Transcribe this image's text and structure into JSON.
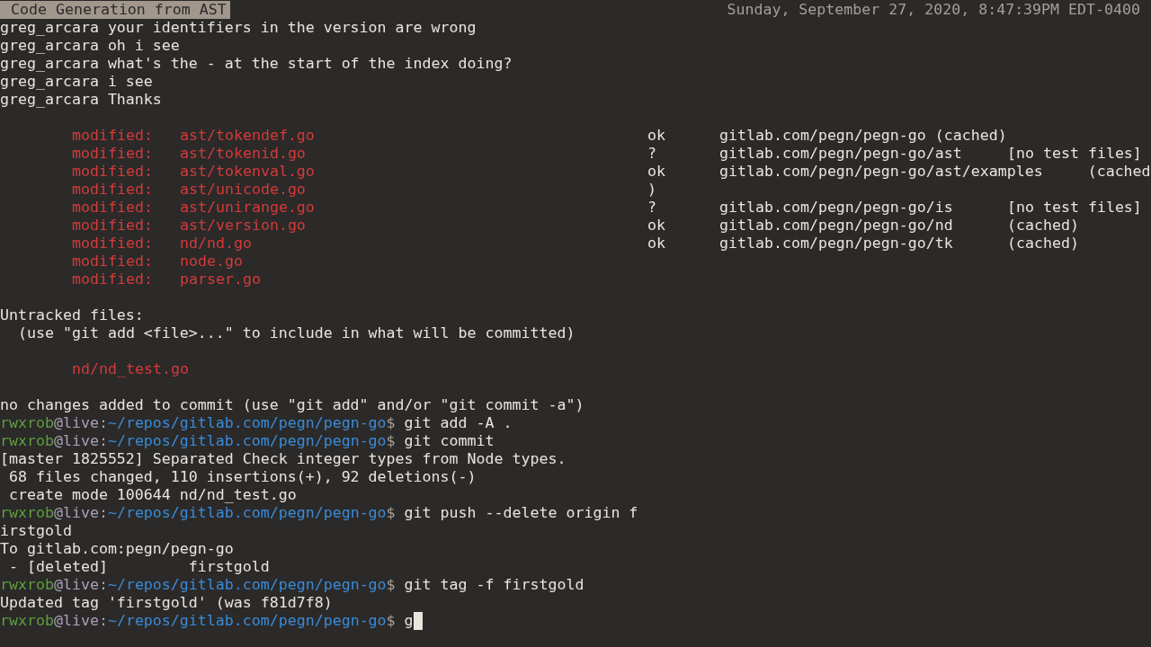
{
  "title_bar": {
    "title": "Code Generation from AST",
    "clock": "Sunday, September 27, 2020, 8:47:39PM EDT-0400"
  },
  "chat": [
    {
      "user": "greg_arcara",
      "message": "your identifiers in the version are wrong"
    },
    {
      "user": "greg_arcara",
      "message": "oh i see"
    },
    {
      "user": "greg_arcara",
      "message": "what's the - at the start of the index doing?"
    },
    {
      "user": "greg_arcara",
      "message": "i see"
    },
    {
      "user": "greg_arcara",
      "message": "Thanks"
    }
  ],
  "modified": [
    {
      "label": "modified:",
      "path": "ast/tokendef.go"
    },
    {
      "label": "modified:",
      "path": "ast/tokenid.go"
    },
    {
      "label": "modified:",
      "path": "ast/tokenval.go"
    },
    {
      "label": "modified:",
      "path": "ast/unicode.go"
    },
    {
      "label": "modified:",
      "path": "ast/unirange.go"
    },
    {
      "label": "modified:",
      "path": "ast/version.go"
    },
    {
      "label": "modified:",
      "path": "nd/nd.go"
    },
    {
      "label": "modified:",
      "path": "node.go"
    },
    {
      "label": "modified:",
      "path": "parser.go"
    }
  ],
  "test_results": [
    {
      "status": "ok",
      "package": "gitlab.com/pegn/pegn-go",
      "note": "(cached)",
      "aligned": false
    },
    {
      "status": "?",
      "package": "gitlab.com/pegn/pegn-go/ast",
      "note": "[no test files]",
      "aligned": true
    },
    {
      "status": "ok",
      "package": "gitlab.com/pegn/pegn-go/ast/examples",
      "note": "(cached",
      "aligned": true
    },
    {
      "status": ")"
    },
    {
      "status": "?",
      "package": "gitlab.com/pegn/pegn-go/is",
      "note": "[no test files]",
      "aligned": true
    },
    {
      "status": "ok",
      "package": "gitlab.com/pegn/pegn-go/nd",
      "note": "(cached)",
      "aligned": true
    },
    {
      "status": "ok",
      "package": "gitlab.com/pegn/pegn-go/tk",
      "note": "(cached)",
      "aligned": true
    }
  ],
  "untracked": {
    "heading": "Untracked files:",
    "hint": "(use \"git add <file>...\" to include in what will be committed)",
    "files": [
      "nd/nd_test.go"
    ]
  },
  "shell": [
    {
      "kind": "output",
      "text": "no changes added to commit (use \"git add\" and/or \"git commit -a\")"
    },
    {
      "kind": "prompt",
      "user": "rwxrob",
      "host": "@live:",
      "path": "~/repos/gitlab.com/pegn/pegn-go",
      "symbol": "$",
      "command": "git add -A .",
      "cursor": false
    },
    {
      "kind": "prompt",
      "user": "rwxrob",
      "host": "@live:",
      "path": "~/repos/gitlab.com/pegn/pegn-go",
      "symbol": "$",
      "command": "git commit",
      "cursor": false
    },
    {
      "kind": "output",
      "text": "[master 1825552] Separated Check integer types from Node types."
    },
    {
      "kind": "output",
      "text": " 68 files changed, 110 insertions(+), 92 deletions(-)"
    },
    {
      "kind": "output",
      "text": " create mode 100644 nd/nd_test.go"
    },
    {
      "kind": "prompt",
      "user": "rwxrob",
      "host": "@live:",
      "path": "~/repos/gitlab.com/pegn/pegn-go",
      "symbol": "$",
      "command": "git push --delete origin f",
      "cursor": false
    },
    {
      "kind": "output",
      "text": "irstgold"
    },
    {
      "kind": "output",
      "text": "To gitlab.com:pegn/pegn-go"
    },
    {
      "kind": "output",
      "text": " - [deleted]         firstgold"
    },
    {
      "kind": "prompt",
      "user": "rwxrob",
      "host": "@live:",
      "path": "~/repos/gitlab.com/pegn/pegn-go",
      "symbol": "$",
      "command": "git tag -f firstgold",
      "cursor": false
    },
    {
      "kind": "output",
      "text": "Updated tag 'firstgold' (was f81d7f8)"
    },
    {
      "kind": "prompt",
      "user": "rwxrob",
      "host": "@live:",
      "path": "~/repos/gitlab.com/pegn/pegn-go",
      "symbol": "$",
      "command": "g",
      "cursor": true
    }
  ]
}
